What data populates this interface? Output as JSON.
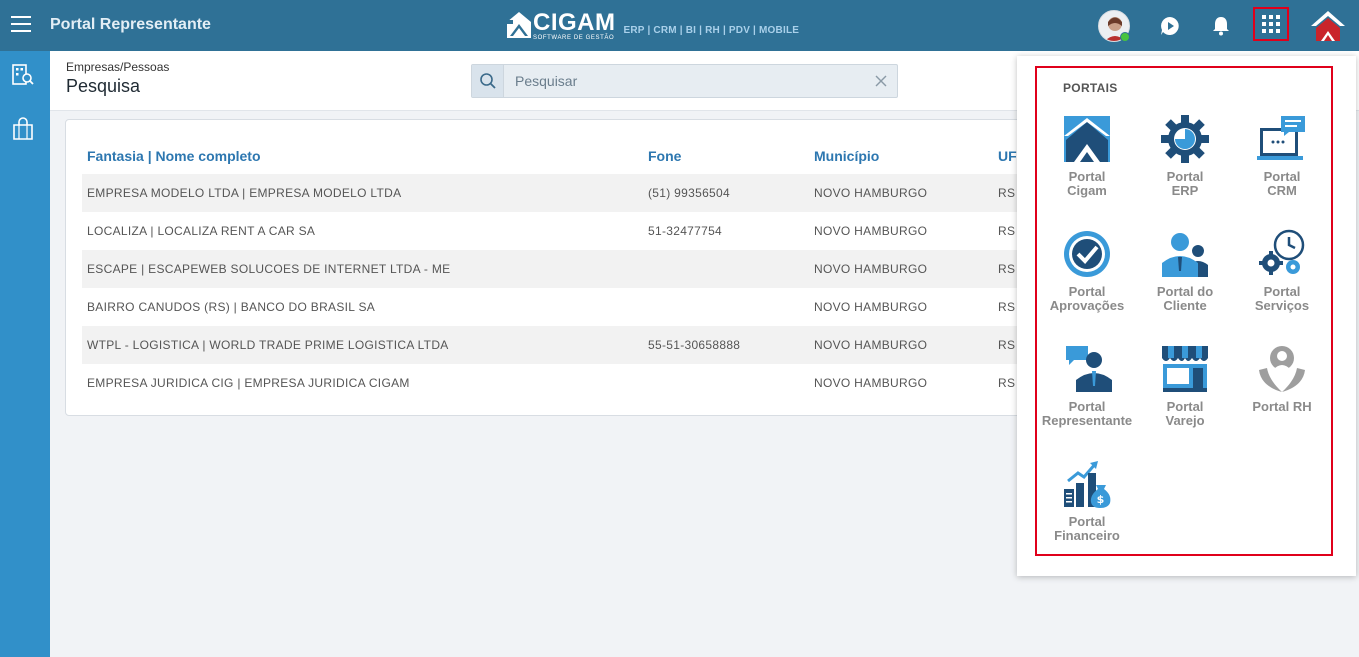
{
  "topbar": {
    "app_title": "Portal Representante",
    "logo_word": "CIGAM",
    "logo_sub": "SOFTWARE DE GESTÃO",
    "logo_modules": "ERP | CRM | BI | RH | PDV | MOBILE"
  },
  "page": {
    "breadcrumb": "Empresas/Pessoas",
    "title": "Pesquisa"
  },
  "search": {
    "placeholder": "Pesquisar",
    "value": ""
  },
  "table": {
    "columns": [
      "Fantasia | Nome completo",
      "Fone",
      "Município",
      "UF"
    ],
    "rows": [
      {
        "name": "EMPRESA MODELO LTDA | EMPRESA MODELO LTDA",
        "phone": "(51) 99356504",
        "city": "NOVO HAMBURGO",
        "uf": "RS"
      },
      {
        "name": "LOCALIZA | LOCALIZA RENT A CAR SA",
        "phone": "51-32477754",
        "city": "NOVO HAMBURGO",
        "uf": "RS"
      },
      {
        "name": "ESCAPE | ESCAPEWEB SOLUCOES DE INTERNET LTDA - ME",
        "phone": "",
        "city": "NOVO HAMBURGO",
        "uf": "RS"
      },
      {
        "name": "BAIRRO CANUDOS (RS) | BANCO DO BRASIL SA",
        "phone": "",
        "city": "NOVO HAMBURGO",
        "uf": "RS"
      },
      {
        "name": "WTPL - LOGISTICA | WORLD TRADE PRIME LOGISTICA LTDA",
        "phone": "55-51-30658888",
        "city": "NOVO HAMBURGO",
        "uf": "RS"
      },
      {
        "name": "EMPRESA JURIDICA CIG | EMPRESA JURIDICA CIGAM",
        "phone": "",
        "city": "NOVO HAMBURGO",
        "uf": "RS"
      }
    ]
  },
  "portals": {
    "title": "PORTAIS",
    "items": [
      {
        "label": "Portal\nCigam",
        "icon": "cigam-house-icon"
      },
      {
        "label": "Portal\nERP",
        "icon": "gear-chart-icon"
      },
      {
        "label": "Portal\nCRM",
        "icon": "monitor-chat-icon"
      },
      {
        "label": "Portal\nAprovações",
        "icon": "check-badge-icon"
      },
      {
        "label": "Portal do\nCliente",
        "icon": "people-icon"
      },
      {
        "label": "Portal\nServiços",
        "icon": "gears-clock-icon"
      },
      {
        "label": "Portal\nRepresentante",
        "icon": "person-speech-icon"
      },
      {
        "label": "Portal\nVarejo",
        "icon": "storefront-icon"
      },
      {
        "label": "Portal RH",
        "icon": "hands-person-icon"
      },
      {
        "label": "Portal\nFinanceiro",
        "icon": "money-growth-icon"
      }
    ]
  },
  "colors": {
    "topbar": "#2f7196",
    "sidebar": "#3190c9",
    "header_text": "#2d77b0",
    "highlight": "#e0001b",
    "portal_icon_dark": "#1f4e79",
    "portal_icon_light": "#3a9ad9"
  }
}
